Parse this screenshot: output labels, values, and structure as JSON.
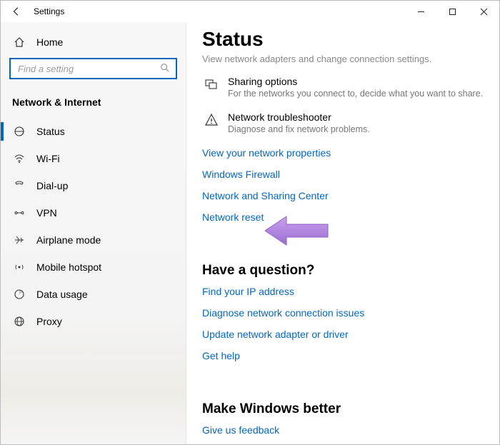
{
  "app": {
    "title": "Settings"
  },
  "sidebar": {
    "home_label": "Home",
    "search": {
      "placeholder": "Find a setting",
      "value": ""
    },
    "section": "Network & Internet",
    "items": [
      {
        "label": "Status",
        "icon": "status-icon"
      },
      {
        "label": "Wi-Fi",
        "icon": "wifi-icon"
      },
      {
        "label": "Dial-up",
        "icon": "dialup-icon"
      },
      {
        "label": "VPN",
        "icon": "vpn-icon"
      },
      {
        "label": "Airplane mode",
        "icon": "airplane-icon"
      },
      {
        "label": "Mobile hotspot",
        "icon": "hotspot-icon"
      },
      {
        "label": "Data usage",
        "icon": "datausage-icon"
      },
      {
        "label": "Proxy",
        "icon": "proxy-icon"
      }
    ]
  },
  "main": {
    "title": "Status",
    "faded": "View network adapters and change connection settings.",
    "sharing": {
      "title": "Sharing options",
      "sub": "For the networks you connect to, decide what you want to share."
    },
    "troubleshooter": {
      "title": "Network troubleshooter",
      "sub": "Diagnose and fix network problems."
    },
    "links": {
      "view_props": "View your network properties",
      "firewall": "Windows Firewall",
      "sharing_center": "Network and Sharing Center",
      "reset": "Network reset"
    },
    "question": {
      "head": "Have a question?",
      "find_ip": "Find your IP address",
      "diagnose": "Diagnose network connection issues",
      "update": "Update network adapter or driver",
      "get_help": "Get help"
    },
    "better": {
      "head": "Make Windows better",
      "feedback": "Give us feedback"
    }
  },
  "colors": {
    "accent": "#0067c0",
    "arrow": "#b07fe0"
  }
}
